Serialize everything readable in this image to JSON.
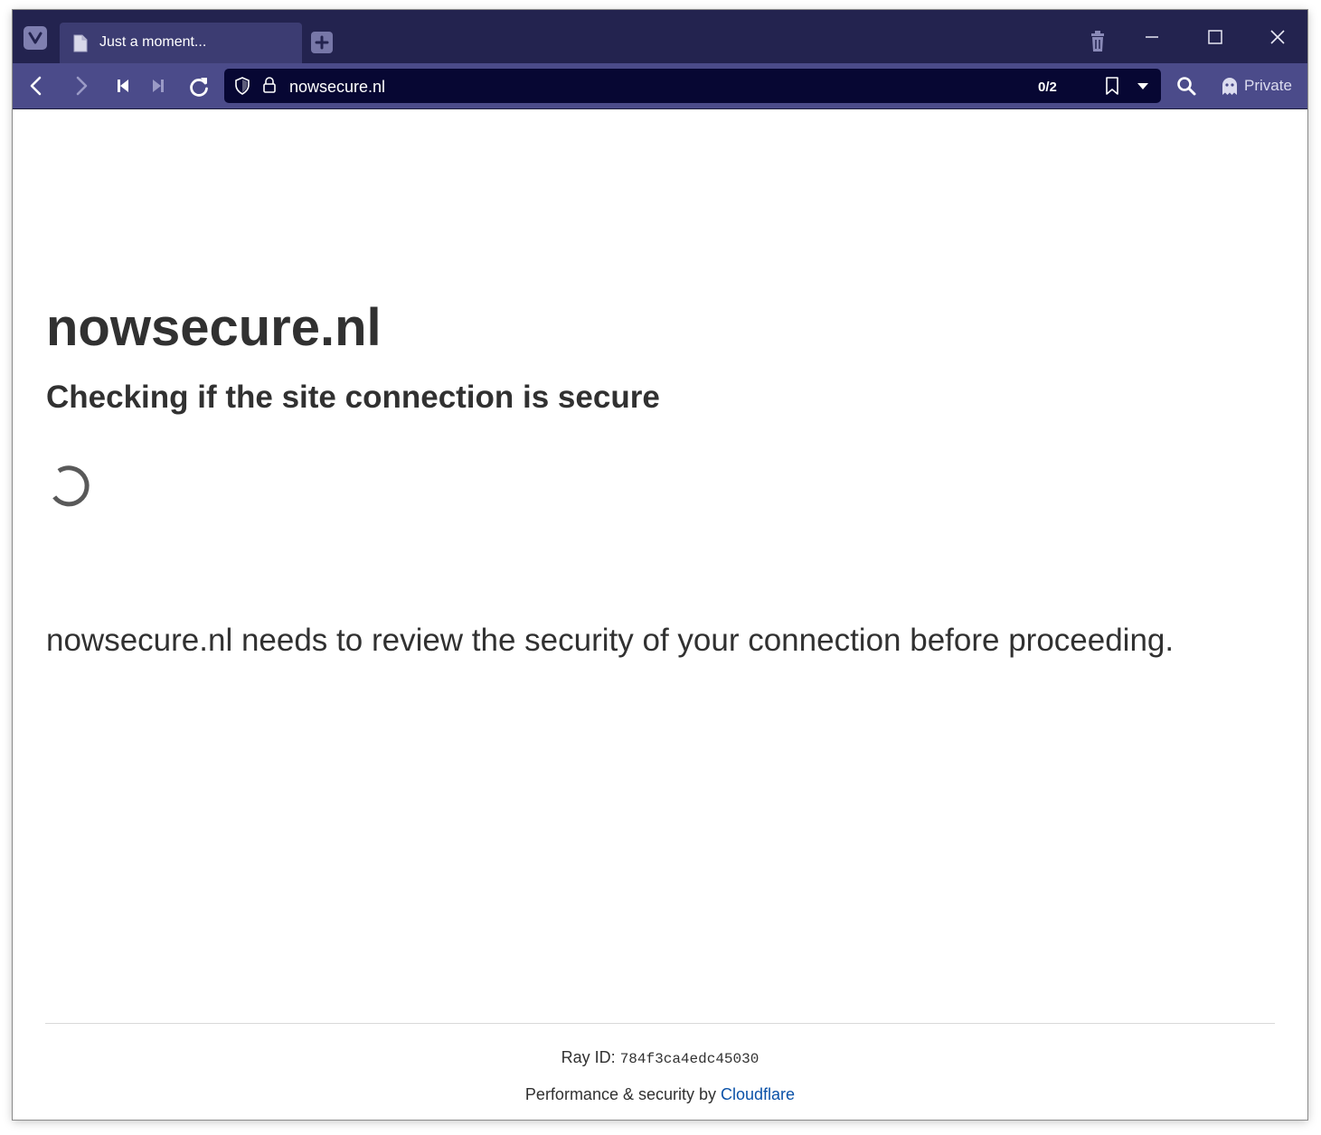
{
  "browser": {
    "tab_title": "Just a moment...",
    "address": "nowsecure.nl",
    "counter": "0/2",
    "private_label": "Private",
    "colors": {
      "tabbar": "#23234f",
      "active_tab": "#3c3c72",
      "navbar": "#4b4b8a",
      "urlbar": "#070733"
    }
  },
  "page": {
    "title": "nowsecure.nl",
    "subtitle": "Checking if the site connection is secure",
    "message": "nowsecure.nl needs to review the security of your connection before proceeding.",
    "ray_label": "Ray ID:",
    "ray_id": "784f3ca4edc45030",
    "footer_prefix": "Performance & security by",
    "footer_link": "Cloudflare",
    "colors": {
      "text": "#313131",
      "link": "#0b52a8"
    }
  },
  "icons": [
    "vivaldi-logo-icon",
    "page-icon",
    "plus-icon",
    "trash-icon",
    "minimize-icon",
    "maximize-icon",
    "close-icon",
    "back-icon",
    "forward-icon",
    "rewind-icon",
    "fast-forward-icon",
    "reload-icon",
    "shield-icon",
    "lock-icon",
    "bookmark-icon",
    "chevron-down-icon",
    "search-icon",
    "ghost-icon",
    "spinner-icon"
  ]
}
